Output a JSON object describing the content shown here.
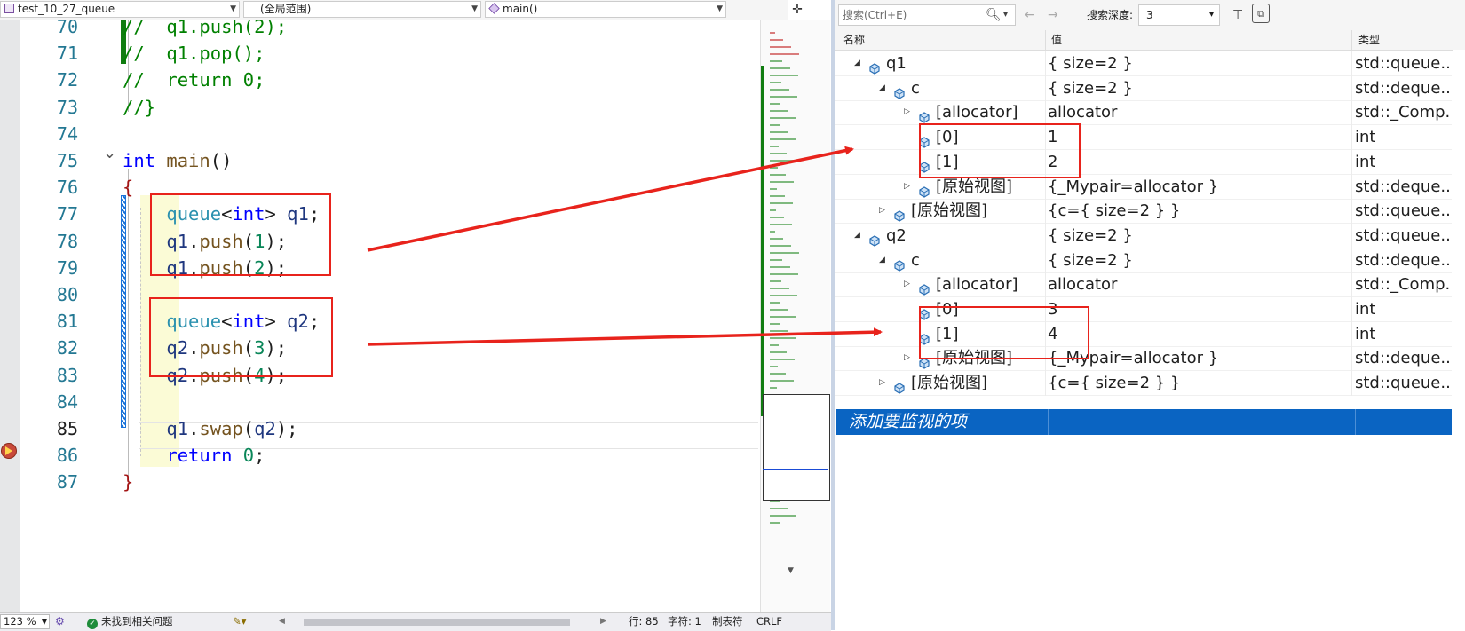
{
  "editor": {
    "nav": {
      "project": "test_10_27_queue",
      "scope": "(全局范围)",
      "member": "main()"
    },
    "lines": [
      {
        "no": "70",
        "tokens": [
          [
            "c",
            "//  "
          ],
          [
            "c",
            "q1.push(2);"
          ]
        ]
      },
      {
        "no": "71",
        "tokens": [
          [
            "c",
            "//  "
          ],
          [
            "c",
            "q1.pop();"
          ]
        ]
      },
      {
        "no": "72",
        "tokens": [
          [
            "c",
            "//  "
          ],
          [
            "c",
            "return 0;"
          ]
        ]
      },
      {
        "no": "73",
        "tokens": [
          [
            "c",
            "//}"
          ]
        ]
      },
      {
        "no": "74",
        "tokens": []
      },
      {
        "no": "75",
        "tokens": [
          [
            "k",
            "int"
          ],
          [
            "p",
            " "
          ],
          [
            "f",
            "main"
          ],
          [
            "p",
            "()"
          ]
        ]
      },
      {
        "no": "76",
        "tokens": [
          [
            "b",
            "{"
          ]
        ]
      },
      {
        "no": "77",
        "tokens": [
          [
            "p",
            "    "
          ],
          [
            "t",
            "queue"
          ],
          [
            "p",
            "<"
          ],
          [
            "k",
            "int"
          ],
          [
            "p",
            "> "
          ],
          [
            "v",
            "q1"
          ],
          [
            "p",
            ";"
          ]
        ]
      },
      {
        "no": "78",
        "tokens": [
          [
            "p",
            "    "
          ],
          [
            "v",
            "q1"
          ],
          [
            "p",
            "."
          ],
          [
            "f",
            "push"
          ],
          [
            "p",
            "("
          ],
          [
            "n",
            "1"
          ],
          [
            "p",
            ");"
          ]
        ]
      },
      {
        "no": "79",
        "tokens": [
          [
            "p",
            "    "
          ],
          [
            "v",
            "q1"
          ],
          [
            "p",
            "."
          ],
          [
            "f",
            "push"
          ],
          [
            "p",
            "("
          ],
          [
            "n",
            "2"
          ],
          [
            "p",
            ");"
          ]
        ]
      },
      {
        "no": "80",
        "tokens": []
      },
      {
        "no": "81",
        "tokens": [
          [
            "p",
            "    "
          ],
          [
            "t",
            "queue"
          ],
          [
            "p",
            "<"
          ],
          [
            "k",
            "int"
          ],
          [
            "p",
            "> "
          ],
          [
            "v",
            "q2"
          ],
          [
            "p",
            ";"
          ]
        ]
      },
      {
        "no": "82",
        "tokens": [
          [
            "p",
            "    "
          ],
          [
            "v",
            "q2"
          ],
          [
            "p",
            "."
          ],
          [
            "f",
            "push"
          ],
          [
            "p",
            "("
          ],
          [
            "n",
            "3"
          ],
          [
            "p",
            ");"
          ]
        ]
      },
      {
        "no": "83",
        "tokens": [
          [
            "p",
            "    "
          ],
          [
            "v",
            "q2"
          ],
          [
            "p",
            "."
          ],
          [
            "f",
            "push"
          ],
          [
            "p",
            "("
          ],
          [
            "n",
            "4"
          ],
          [
            "p",
            ");"
          ]
        ]
      },
      {
        "no": "84",
        "tokens": []
      },
      {
        "no": "85",
        "tokens": [
          [
            "p",
            "    "
          ],
          [
            "v",
            "q1"
          ],
          [
            "p",
            "."
          ],
          [
            "f",
            "swap"
          ],
          [
            "p",
            "("
          ],
          [
            "v",
            "q2"
          ],
          [
            "p",
            ");"
          ]
        ]
      },
      {
        "no": "86",
        "tokens": [
          [
            "p",
            "    "
          ],
          [
            "k",
            "return"
          ],
          [
            "p",
            " "
          ],
          [
            "n",
            "0"
          ],
          [
            "p",
            ";"
          ]
        ]
      },
      {
        "no": "87",
        "tokens": [
          [
            "b",
            "}"
          ]
        ]
      }
    ],
    "current_line": "85",
    "status": {
      "zoom": "123 %",
      "issues": "未找到相关问题",
      "line": "行: 85",
      "char": "字符: 1",
      "tabs": "制表符",
      "eol": "CRLF"
    }
  },
  "watch": {
    "search_placeholder": "搜索(Ctrl+E)",
    "depth_label": "搜索深度:",
    "depth_value": "3",
    "columns": {
      "name": "名称",
      "value": "值",
      "type": "类型"
    },
    "rows": [
      {
        "level": 0,
        "expand": "open",
        "name": "q1",
        "value": "{ size=2 }",
        "type": "std::queue..."
      },
      {
        "level": 1,
        "expand": "open",
        "name": "c",
        "value": "{ size=2 }",
        "type": "std::deque..."
      },
      {
        "level": 2,
        "expand": "closed",
        "name": "[allocator]",
        "value": "allocator",
        "type": "std::_Comp..."
      },
      {
        "level": 2,
        "expand": "none",
        "name": "[0]",
        "value": "1",
        "type": "int"
      },
      {
        "level": 2,
        "expand": "none",
        "name": "[1]",
        "value": "2",
        "type": "int"
      },
      {
        "level": 2,
        "expand": "closed",
        "name": "[原始视图]",
        "value": "{_Mypair=allocator }",
        "type": "std::deque..."
      },
      {
        "level": 1,
        "expand": "closed",
        "name": "[原始视图]",
        "value": "{c={ size=2 } }",
        "type": "std::queue..."
      },
      {
        "level": 0,
        "expand": "open",
        "name": "q2",
        "value": "{ size=2 }",
        "type": "std::queue..."
      },
      {
        "level": 1,
        "expand": "open",
        "name": "c",
        "value": "{ size=2 }",
        "type": "std::deque..."
      },
      {
        "level": 2,
        "expand": "closed",
        "name": "[allocator]",
        "value": "allocator",
        "type": "std::_Comp..."
      },
      {
        "level": 2,
        "expand": "none",
        "name": "[0]",
        "value": "3",
        "type": "int"
      },
      {
        "level": 2,
        "expand": "none",
        "name": "[1]",
        "value": "4",
        "type": "int"
      },
      {
        "level": 2,
        "expand": "closed",
        "name": "[原始视图]",
        "value": "{_Mypair=allocator }",
        "type": "std::deque..."
      },
      {
        "level": 1,
        "expand": "closed",
        "name": "[原始视图]",
        "value": "{c={ size=2 } }",
        "type": "std::queue..."
      }
    ],
    "add_item": "添加要监视的项"
  },
  "colors": {
    "annotation_red": "#e8231c",
    "selection_blue": "#0a64c2",
    "comment_green": "#008000",
    "keyword_blue": "#0000ff"
  }
}
